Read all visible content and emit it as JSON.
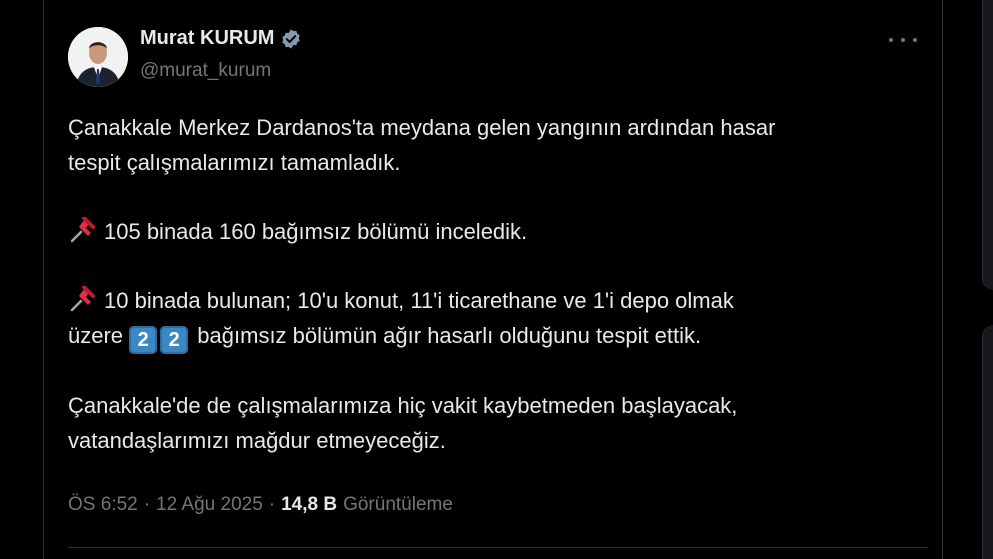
{
  "author": {
    "display_name": "Murat KURUM",
    "handle": "@murat_kurum"
  },
  "tweet": {
    "line1": "Çanakkale Merkez Dardanos'ta meydana gelen yangının ardından hasar",
    "line2": "tespit çalışmalarımızı tamamladık.",
    "bullet1": "105 binada 160 bağımsız bölümü inceledik.",
    "bullet2_line1": "10 binada bulunan; 10'u konut, 11'i ticarethane ve 1'i depo olmak",
    "bullet2_prefix": "üzere",
    "bullet2_keycap1": "2",
    "bullet2_keycap2": "2",
    "bullet2_suffix": "bağımsız bölümün ağır hasarlı olduğunu tespit ettik.",
    "closing_line1": "Çanakkale'de de çalışmalarımıza hiç vakit kaybetmeden başlayacak,",
    "closing_line2": "vatandaşlarımızı mağdur etmeyeceğiz."
  },
  "meta": {
    "time": "ÖS 6:52",
    "sep1": "·",
    "date": "12 Ağu 2025",
    "sep2": "·",
    "views_count": "14,8 B",
    "views_label": "Görüntüleme"
  },
  "icons": {
    "verified": "verified-badge-icon",
    "more": "more-icon",
    "pin": "pushpin-emoji"
  },
  "colors": {
    "background": "#000000",
    "text": "#e7e9ea",
    "secondary": "#71767b",
    "verified": "#829aab",
    "keycap": "#3b88c3"
  }
}
